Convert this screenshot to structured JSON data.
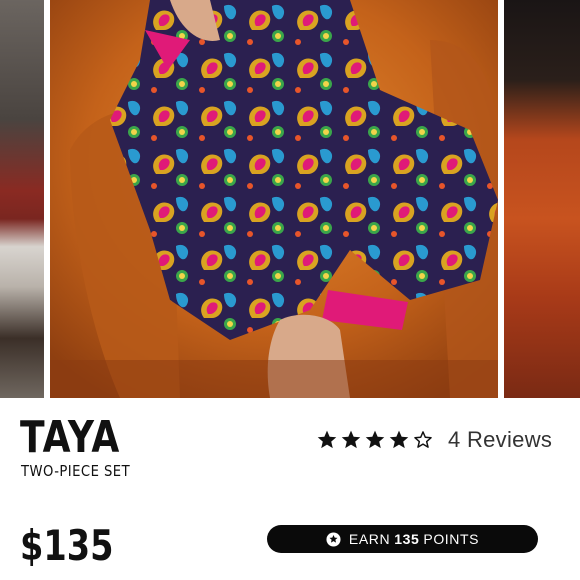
{
  "gallery": {
    "main_image_alt": "",
    "colors": {
      "chair": "#c46a1e",
      "fabric_base": "#2b2050",
      "trim": "#e01a78"
    }
  },
  "product": {
    "name": "TAYA",
    "subtitle": "TWO-PIECE SET",
    "price": "$135"
  },
  "rating": {
    "stars_filled": 4,
    "stars_total": 5,
    "reviews_label": "4 Reviews"
  },
  "rewards": {
    "prefix": "EARN",
    "points": "135",
    "suffix": "POINTS",
    "icon": "star-circle-icon"
  },
  "colors": {
    "accent": "#0a0a0a",
    "text": "#111111"
  }
}
